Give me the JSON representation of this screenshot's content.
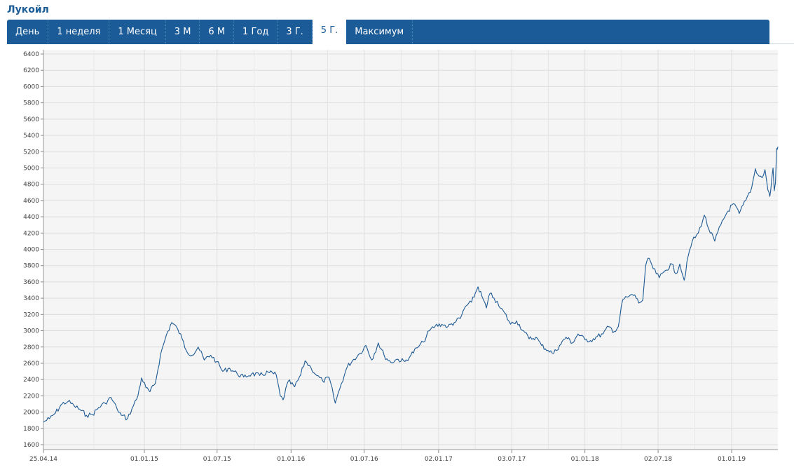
{
  "header": {
    "title": "Лукойл"
  },
  "tabs": [
    {
      "label": "День",
      "active": false
    },
    {
      "label": "1 неделя",
      "active": false
    },
    {
      "label": "1 Месяц",
      "active": false
    },
    {
      "label": "3 М",
      "active": false
    },
    {
      "label": "6 М",
      "active": false
    },
    {
      "label": "1 Год",
      "active": false
    },
    {
      "label": "3 Г.",
      "active": false
    },
    {
      "label": "5 Г.",
      "active": true
    },
    {
      "label": "Максимум",
      "active": false
    }
  ],
  "colors": {
    "tab_bar": "#1a5b98",
    "line": "#1e5a94",
    "plot_bg": "#f5f5f5",
    "grid": "#dddddd"
  },
  "chart_data": {
    "type": "line",
    "ylim": [
      1600,
      6400
    ],
    "yticks": [
      1600,
      1800,
      2000,
      2200,
      2400,
      2600,
      2800,
      3000,
      3200,
      3400,
      3600,
      3800,
      4000,
      4200,
      4400,
      4600,
      4800,
      5000,
      5200,
      5400,
      5600,
      5800,
      6000,
      6200,
      6400
    ],
    "xlim": [
      "2014-04-25",
      "2019-04-26"
    ],
    "xticks": [
      {
        "date": "2014-04-25",
        "label": "25.04.14"
      },
      {
        "date": "2015-01-01",
        "label": "01.01.15"
      },
      {
        "date": "2015-07-01",
        "label": "01.07.15"
      },
      {
        "date": "2016-01-01",
        "label": "01.01.16"
      },
      {
        "date": "2016-07-01",
        "label": "01.07.16"
      },
      {
        "date": "2017-01-02",
        "label": "02.01.17"
      },
      {
        "date": "2017-07-03",
        "label": "03.07.17"
      },
      {
        "date": "2018-01-01",
        "label": "01.01.18"
      },
      {
        "date": "2018-07-02",
        "label": "02.07.18"
      },
      {
        "date": "2019-01-01",
        "label": "01.01.19"
      }
    ],
    "grid": true,
    "series": [
      {
        "points": [
          [
            "2014-04-25",
            1880
          ],
          [
            "2014-05-10",
            1920
          ],
          [
            "2014-05-25",
            1990
          ],
          [
            "2014-06-10",
            2100
          ],
          [
            "2014-06-25",
            2130
          ],
          [
            "2014-07-10",
            2080
          ],
          [
            "2014-07-25",
            2030
          ],
          [
            "2014-08-10",
            1960
          ],
          [
            "2014-08-25",
            1970
          ],
          [
            "2014-09-10",
            2060
          ],
          [
            "2014-09-25",
            2110
          ],
          [
            "2014-10-10",
            2180
          ],
          [
            "2014-10-25",
            2040
          ],
          [
            "2014-11-05",
            1960
          ],
          [
            "2014-11-20",
            1920
          ],
          [
            "2014-12-05",
            2080
          ],
          [
            "2014-12-16",
            2200
          ],
          [
            "2014-12-25",
            2420
          ],
          [
            "2015-01-05",
            2300
          ],
          [
            "2015-01-15",
            2250
          ],
          [
            "2015-01-28",
            2350
          ],
          [
            "2015-02-10",
            2700
          ],
          [
            "2015-02-25",
            2950
          ],
          [
            "2015-03-10",
            3100
          ],
          [
            "2015-03-25",
            3020
          ],
          [
            "2015-04-05",
            2900
          ],
          [
            "2015-04-15",
            2760
          ],
          [
            "2015-04-30",
            2700
          ],
          [
            "2015-05-15",
            2800
          ],
          [
            "2015-05-30",
            2640
          ],
          [
            "2015-06-15",
            2700
          ],
          [
            "2015-06-30",
            2620
          ],
          [
            "2015-07-15",
            2500
          ],
          [
            "2015-08-01",
            2540
          ],
          [
            "2015-08-20",
            2470
          ],
          [
            "2015-09-05",
            2430
          ],
          [
            "2015-09-25",
            2470
          ],
          [
            "2015-10-15",
            2450
          ],
          [
            "2015-11-05",
            2490
          ],
          [
            "2015-11-25",
            2460
          ],
          [
            "2015-12-05",
            2200
          ],
          [
            "2015-12-12",
            2150
          ],
          [
            "2015-12-25",
            2380
          ],
          [
            "2016-01-10",
            2310
          ],
          [
            "2016-01-25",
            2460
          ],
          [
            "2016-02-05",
            2630
          ],
          [
            "2016-02-20",
            2540
          ],
          [
            "2016-03-05",
            2450
          ],
          [
            "2016-03-20",
            2380
          ],
          [
            "2016-04-05",
            2420
          ],
          [
            "2016-04-20",
            2110
          ],
          [
            "2016-05-05",
            2350
          ],
          [
            "2016-05-20",
            2560
          ],
          [
            "2016-06-05",
            2650
          ],
          [
            "2016-06-20",
            2720
          ],
          [
            "2016-07-05",
            2820
          ],
          [
            "2016-07-20",
            2640
          ],
          [
            "2016-08-05",
            2850
          ],
          [
            "2016-08-20",
            2690
          ],
          [
            "2016-09-05",
            2610
          ],
          [
            "2016-09-20",
            2650
          ],
          [
            "2016-10-10",
            2620
          ],
          [
            "2016-10-25",
            2700
          ],
          [
            "2016-11-10",
            2790
          ],
          [
            "2016-11-25",
            2860
          ],
          [
            "2016-12-10",
            3000
          ],
          [
            "2016-12-25",
            3060
          ],
          [
            "2017-01-10",
            3080
          ],
          [
            "2017-01-25",
            3050
          ],
          [
            "2017-02-10",
            3100
          ],
          [
            "2017-02-25",
            3150
          ],
          [
            "2017-03-10",
            3300
          ],
          [
            "2017-03-25",
            3350
          ],
          [
            "2017-04-10",
            3540
          ],
          [
            "2017-04-20",
            3420
          ],
          [
            "2017-05-01",
            3280
          ],
          [
            "2017-05-10",
            3460
          ],
          [
            "2017-05-20",
            3400
          ],
          [
            "2017-06-01",
            3300
          ],
          [
            "2017-06-15",
            3220
          ],
          [
            "2017-06-30",
            3080
          ],
          [
            "2017-07-15",
            3120
          ],
          [
            "2017-08-01",
            3000
          ],
          [
            "2017-08-15",
            2900
          ],
          [
            "2017-09-01",
            2920
          ],
          [
            "2017-09-15",
            2820
          ],
          [
            "2017-10-01",
            2760
          ],
          [
            "2017-10-15",
            2720
          ],
          [
            "2017-10-30",
            2820
          ],
          [
            "2017-11-15",
            2920
          ],
          [
            "2017-12-01",
            2850
          ],
          [
            "2017-12-15",
            2960
          ],
          [
            "2018-01-01",
            2890
          ],
          [
            "2018-01-15",
            2880
          ],
          [
            "2018-02-01",
            2930
          ],
          [
            "2018-02-15",
            2960
          ],
          [
            "2018-03-01",
            3050
          ],
          [
            "2018-03-15",
            2990
          ],
          [
            "2018-03-25",
            3050
          ],
          [
            "2018-04-05",
            3380
          ],
          [
            "2018-04-20",
            3420
          ],
          [
            "2018-05-05",
            3440
          ],
          [
            "2018-05-15",
            3340
          ],
          [
            "2018-05-25",
            3380
          ],
          [
            "2018-06-01",
            3800
          ],
          [
            "2018-06-10",
            3890
          ],
          [
            "2018-06-20",
            3760
          ],
          [
            "2018-07-05",
            3650
          ],
          [
            "2018-07-20",
            3740
          ],
          [
            "2018-08-05",
            3820
          ],
          [
            "2018-08-15",
            3700
          ],
          [
            "2018-08-25",
            3820
          ],
          [
            "2018-09-05",
            3620
          ],
          [
            "2018-09-15",
            3920
          ],
          [
            "2018-09-25",
            4100
          ],
          [
            "2018-10-10",
            4200
          ],
          [
            "2018-10-25",
            4420
          ],
          [
            "2018-11-05",
            4250
          ],
          [
            "2018-11-20",
            4100
          ],
          [
            "2018-12-05",
            4300
          ],
          [
            "2018-12-20",
            4450
          ],
          [
            "2019-01-05",
            4560
          ],
          [
            "2019-01-20",
            4440
          ],
          [
            "2019-02-05",
            4600
          ],
          [
            "2019-02-20",
            4760
          ],
          [
            "2019-03-01",
            4990
          ],
          [
            "2019-03-10",
            4900
          ],
          [
            "2019-03-18",
            4880
          ],
          [
            "2019-03-25",
            4980
          ],
          [
            "2019-04-01",
            4730
          ],
          [
            "2019-04-06",
            4650
          ],
          [
            "2019-04-10",
            4820
          ],
          [
            "2019-04-14",
            5000
          ],
          [
            "2019-04-17",
            4720
          ],
          [
            "2019-04-20",
            4820
          ],
          [
            "2019-04-23",
            5240
          ],
          [
            "2019-04-26",
            5260
          ]
        ]
      }
    ]
  }
}
